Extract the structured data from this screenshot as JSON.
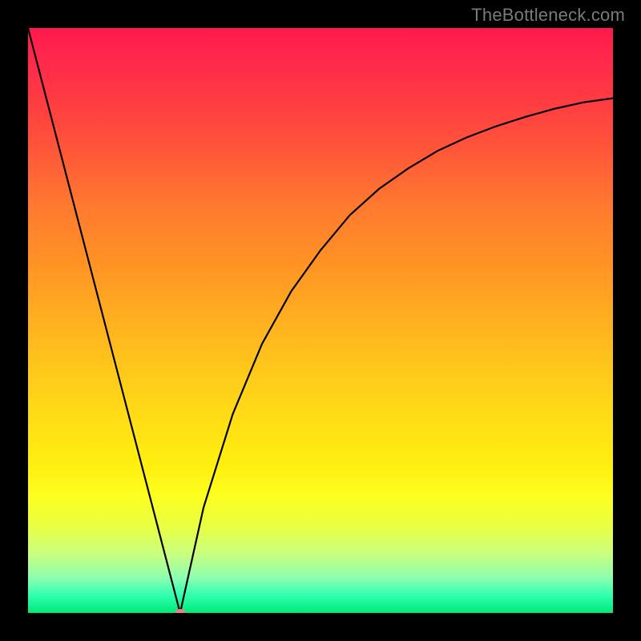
{
  "watermark": "TheBottleneck.com",
  "chart_data": {
    "type": "line",
    "title": "",
    "xlabel": "",
    "ylabel": "",
    "xlim": [
      0,
      100
    ],
    "ylim": [
      0,
      100
    ],
    "grid": false,
    "curve_left": {
      "x": [
        0,
        26
      ],
      "y": [
        100,
        0
      ]
    },
    "curve_right": {
      "x": [
        26,
        30,
        35,
        40,
        45,
        50,
        55,
        60,
        65,
        70,
        75,
        80,
        85,
        90,
        95,
        100
      ],
      "y": [
        0,
        18,
        34,
        46,
        55,
        62,
        68,
        72.5,
        76,
        79,
        81.3,
        83.2,
        84.8,
        86.2,
        87.3,
        88
      ]
    },
    "marker": {
      "x": 26,
      "y": 0
    }
  },
  "colors": {
    "curve_stroke": "#000000",
    "marker_fill": "#e38585",
    "background_top": "#ff1a4d",
    "background_bottom": "#00e878",
    "frame": "#000000",
    "watermark": "#7a7a7a"
  }
}
